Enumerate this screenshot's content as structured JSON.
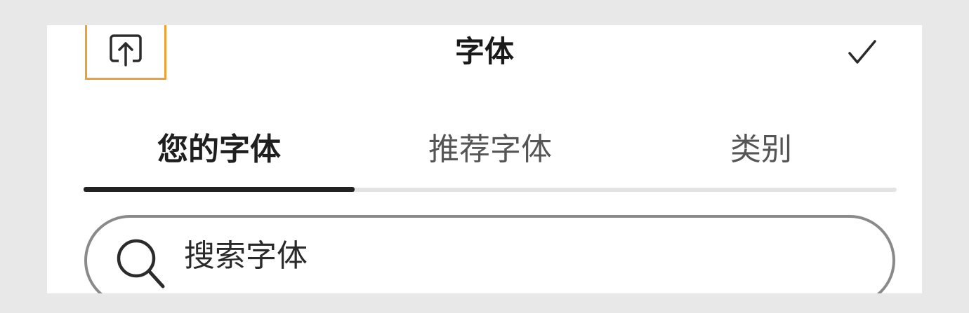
{
  "header": {
    "title": "字体",
    "upload_icon": "upload-icon",
    "confirm_icon": "checkmark-icon",
    "highlight_color": "#f0a030"
  },
  "tabs": [
    {
      "label": "您的字体",
      "active": true
    },
    {
      "label": "推荐字体",
      "active": false
    },
    {
      "label": "类别",
      "active": false
    }
  ],
  "search": {
    "placeholder": "搜索字体",
    "value": "",
    "icon": "search-icon"
  }
}
